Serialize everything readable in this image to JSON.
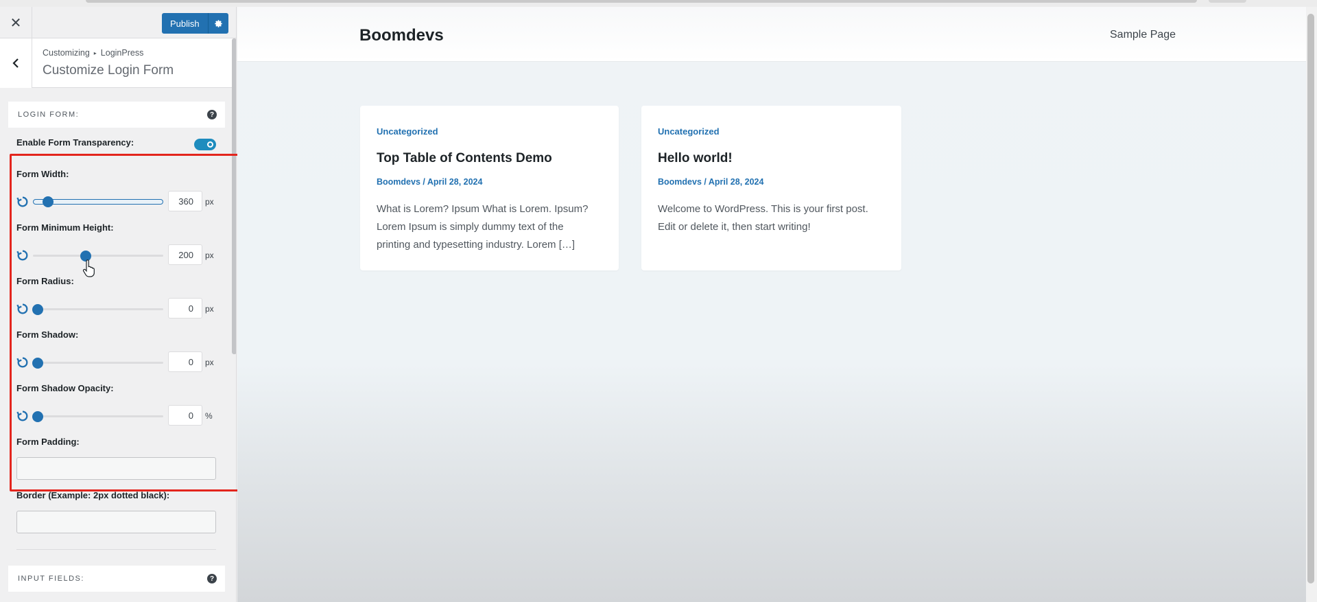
{
  "sidebar": {
    "publish_label": "Publish",
    "breadcrumb_parent": "Customizing",
    "breadcrumb_child": "LoginPress",
    "panel_title": "Customize Login Form",
    "login_form_section": "LOGIN FORM:",
    "transparency_label": "Enable Form Transparency:",
    "transparency_enabled": true,
    "controls": [
      {
        "label": "Form Width:",
        "value": "360",
        "unit": "px"
      },
      {
        "label": "Form Minimum Height:",
        "value": "200",
        "unit": "px"
      },
      {
        "label": "Form Radius:",
        "value": "0",
        "unit": "px"
      },
      {
        "label": "Form Shadow:",
        "value": "0",
        "unit": "px"
      },
      {
        "label": "Form Shadow Opacity:",
        "value": "0",
        "unit": "%"
      }
    ],
    "padding_label": "Form Padding:",
    "border_label": "Border (Example: 2px dotted black):",
    "input_fields_section": "INPUT FIELDS:"
  },
  "preview": {
    "site_title": "Boomdevs",
    "nav_item": "Sample Page",
    "posts": [
      {
        "category": "Uncategorized",
        "title": "Top Table of Contents Demo",
        "meta": "Boomdevs / April 28, 2024",
        "excerpt_lines": [
          "What is Lorem? Ipsum What is Lorem. Ipsum?",
          "Lorem Ipsum is simply dummy text of the",
          "printing and typesetting industry. Lorem […]"
        ]
      },
      {
        "category": "Uncategorized",
        "title": "Hello world!",
        "meta": "Boomdevs / April 28, 2024",
        "excerpt_lines": [
          "Welcome to WordPress. This is your first post.",
          "Edit or delete it, then start writing!"
        ]
      }
    ]
  },
  "colors": {
    "accent": "#2271b1",
    "highlight_box": "#e3251d"
  }
}
